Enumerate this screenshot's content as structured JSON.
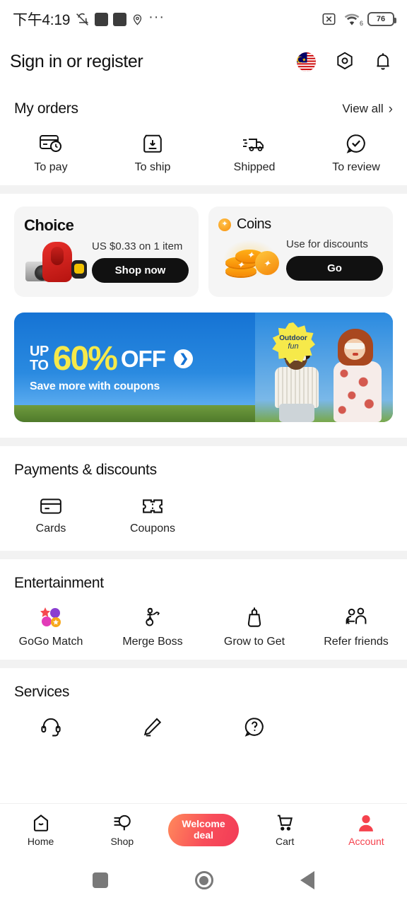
{
  "status_bar": {
    "time": "下午4:19",
    "icons_left": [
      "mute-icon",
      "app-square-1",
      "app-square-2",
      "location-pin-icon",
      "ellipsis-icon"
    ],
    "icons_right": [
      "cast-disabled-icon",
      "wifi-icon"
    ],
    "wifi_label": "6",
    "battery_level": "76"
  },
  "header": {
    "title": "Sign in or register",
    "icons": [
      "country-flag-malaysia",
      "settings-icon",
      "notification-bell-icon"
    ]
  },
  "orders": {
    "title": "My orders",
    "view_all": "View all",
    "items": [
      {
        "label": "To pay",
        "icon": "card-clock-icon"
      },
      {
        "label": "To ship",
        "icon": "box-download-icon"
      },
      {
        "label": "Shipped",
        "icon": "truck-icon"
      },
      {
        "label": "To review",
        "icon": "comment-check-icon"
      }
    ]
  },
  "promo_cards": {
    "choice": {
      "title": "Choice",
      "desc": "US $0.33 on 1 item",
      "button": "Shop now",
      "image": "backpack-camera-watch-photo"
    },
    "coins": {
      "title": "Coins",
      "desc": "Use for discounts",
      "button": "Go",
      "icon": "coin-icon",
      "image": "gold-coins-stack-photo"
    }
  },
  "banner": {
    "line_up": "UP",
    "line_to": "TO",
    "percent": "60%",
    "off": "OFF",
    "subtitle": "Save more with coupons",
    "badge_top": "Outdoor",
    "badge_bottom": "fun",
    "arrow_icon": "chevron-right-icon",
    "colors": {
      "bg": "#1573d4",
      "accent": "#f6e94a",
      "grass": "#5f8c33"
    }
  },
  "payments": {
    "title": "Payments & discounts",
    "items": [
      {
        "label": "Cards",
        "icon": "credit-card-icon"
      },
      {
        "label": "Coupons",
        "icon": "coupon-ticket-icon"
      }
    ]
  },
  "entertainment": {
    "title": "Entertainment",
    "items": [
      {
        "label": "GoGo Match",
        "icon": "gogo-match-icon"
      },
      {
        "label": "Merge Boss",
        "icon": "merge-boss-icon"
      },
      {
        "label": "Grow to Get",
        "icon": "watering-pot-icon"
      },
      {
        "label": "Refer friends",
        "icon": "two-people-icon"
      }
    ]
  },
  "services": {
    "title": "Services",
    "items": [
      {
        "label": "",
        "icon": "headset-icon"
      },
      {
        "label": "",
        "icon": "pencil-icon"
      },
      {
        "label": "",
        "icon": "question-bubble-icon"
      }
    ]
  },
  "bottom_nav": {
    "items": [
      {
        "label": "Home",
        "icon": "home-icon",
        "active": false
      },
      {
        "label": "Shop",
        "icon": "shop-icon",
        "active": false
      },
      {
        "label": "Cart",
        "icon": "cart-icon",
        "active": false
      },
      {
        "label": "Account",
        "icon": "account-icon",
        "active": true
      }
    ],
    "welcome_deal": "Welcome\ndeal",
    "welcome_deal_line1": "Welcome",
    "welcome_deal_line2": "deal",
    "active_color": "#f5424d"
  },
  "system_nav": {
    "recents": "recents-square-icon",
    "home": "home-circle-icon",
    "back": "back-triangle-icon"
  }
}
